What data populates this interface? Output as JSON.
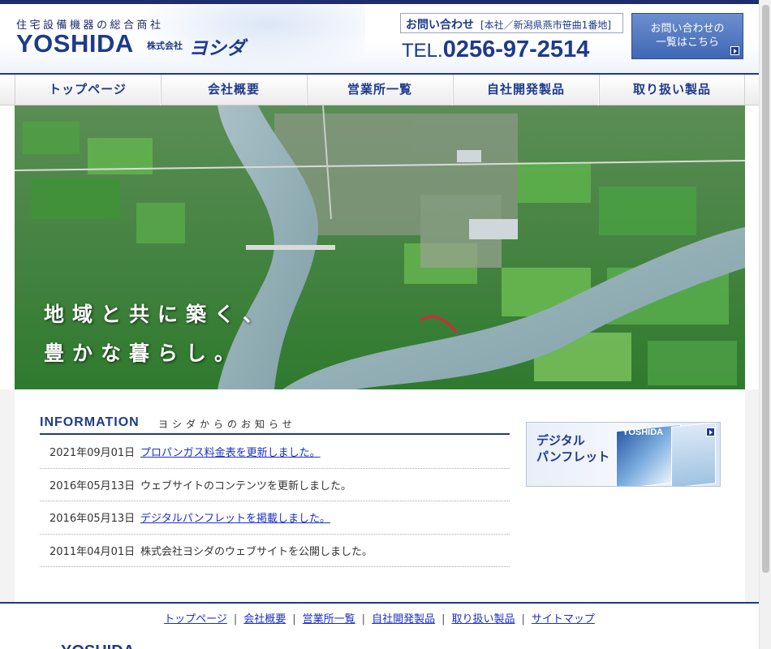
{
  "header": {
    "tagline": "住宅設備機器の総合商社",
    "logo_main": "YOSHIDA",
    "logo_kk": "株式会社",
    "logo_kana": "ヨシダ",
    "contact_label": "お問い合わせ",
    "contact_address": "[本社／新潟県燕市笹曲1番地]",
    "tel_prefix": "TEL.",
    "tel_number": "0256-97-2514",
    "contact_button_line1": "お問い合わせの",
    "contact_button_line2": "一覧はこちら"
  },
  "nav": {
    "items": [
      {
        "label": "トップページ"
      },
      {
        "label": "会社概要"
      },
      {
        "label": "営業所一覧"
      },
      {
        "label": "自社開発製品"
      },
      {
        "label": "取り扱い製品"
      }
    ]
  },
  "hero": {
    "slogan_line1": "地域と共に築く、",
    "slogan_line2": "豊かな暮らし。"
  },
  "information": {
    "title": "INFORMATION",
    "subtitle": "ヨシダからのお知らせ",
    "items": [
      {
        "date": "2021年09月01日",
        "text": "プロパンガス料金表を更新しました。",
        "link": true
      },
      {
        "date": "2016年05月13日",
        "text": "ウェブサイトのコンテンツを更新しました。",
        "link": false
      },
      {
        "date": "2016年05月13日",
        "text": "デジタルパンフレットを掲載しました。",
        "link": true
      },
      {
        "date": "2011年04月01日",
        "text": "株式会社ヨシダのウェブサイトを公開しました。",
        "link": false
      }
    ]
  },
  "pamphlet": {
    "line1": "デジタル",
    "line2": "パンフレット",
    "cover_word": "YOSHIDA"
  },
  "footer": {
    "links": [
      {
        "label": "トップページ"
      },
      {
        "label": "会社概要"
      },
      {
        "label": "営業所一覧"
      },
      {
        "label": "自社開発製品"
      },
      {
        "label": "取り扱い製品"
      },
      {
        "label": "サイトマップ"
      }
    ],
    "logo_partial": "YOSHIDA"
  },
  "colors": {
    "brand_navy": "#1e3a8c",
    "link_blue": "#1a2fc8"
  }
}
